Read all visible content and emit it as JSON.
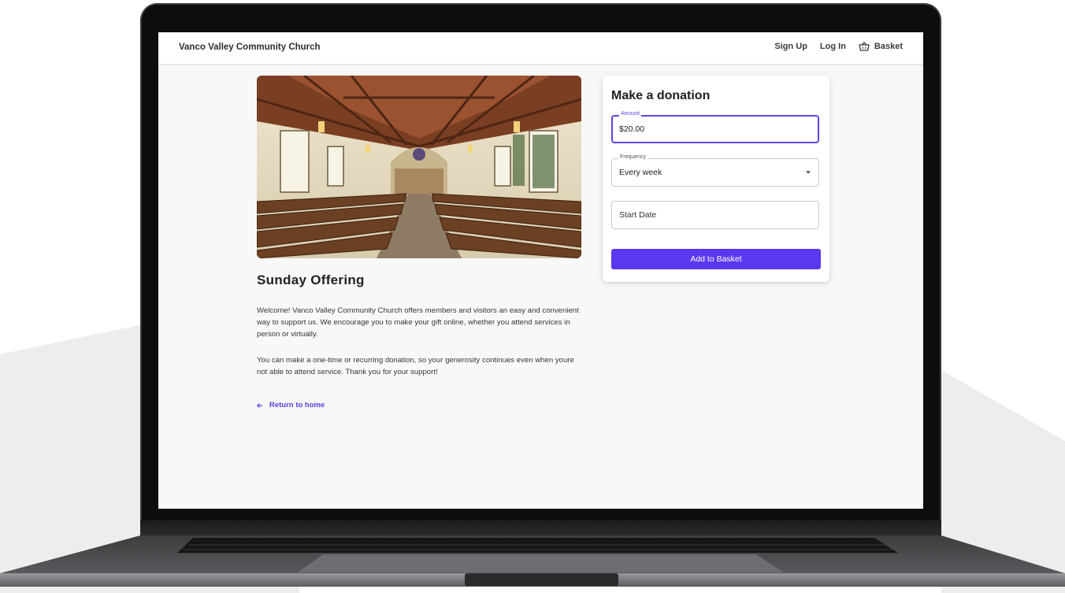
{
  "navbar": {
    "brand": "Vanco Valley Community Church",
    "signup_label": "Sign Up",
    "login_label": "Log In",
    "basket_label": "Basket"
  },
  "main": {
    "hero_image": "church-interior-photo",
    "title": "Sunday Offering",
    "paragraph_1": "Welcome! Vanco Valley Community Church offers members and visitors an easy and convenient way to support us. We encourage you to make your gift online, whether you attend services in person or virtually.",
    "paragraph_2": "You can make a one-time or recurring donation, so your generosity continues even when youre not able to attend service. Thank you for your support!",
    "return_label": "Return to home"
  },
  "donation": {
    "heading": "Make a donation",
    "amount_label": "Amount",
    "amount_value": "$20.00",
    "frequency_label": "Frequency",
    "frequency_value": "Every week",
    "start_date_placeholder": "Start Date",
    "add_button_label": "Add to Basket"
  },
  "colors": {
    "accent": "#5b38f0",
    "page_bg": "#f8f8f8",
    "laptop_frame": "#0d0d0e"
  }
}
